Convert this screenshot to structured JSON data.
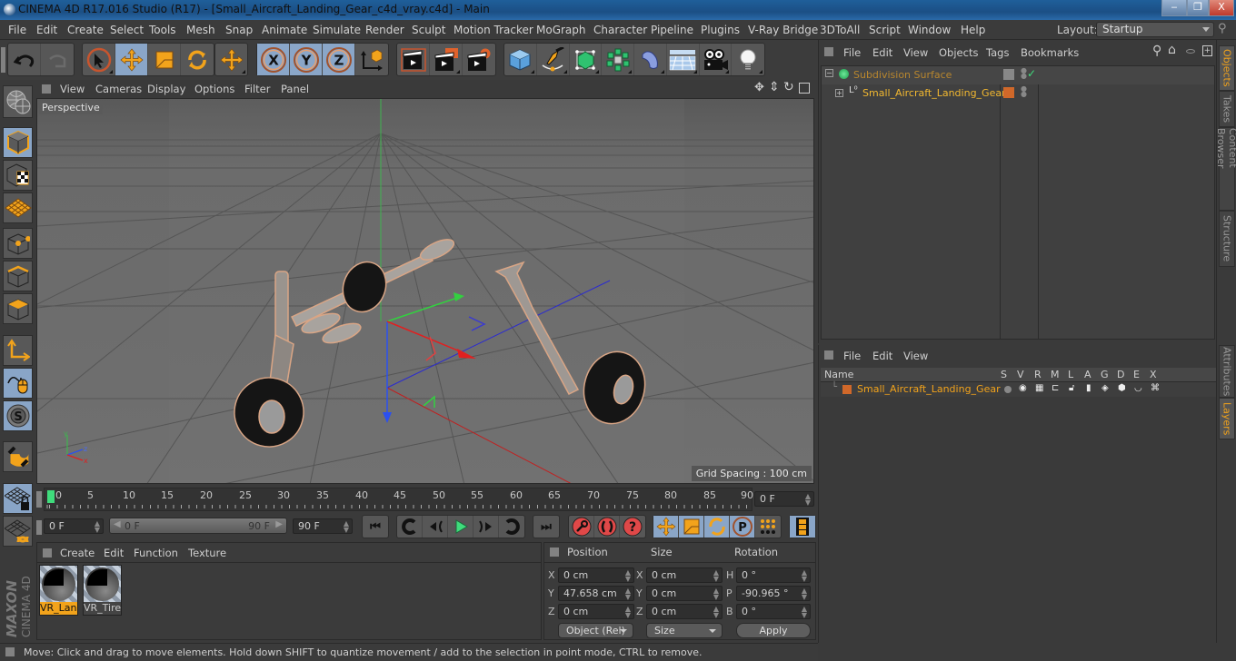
{
  "window": {
    "title": "CINEMA 4D R17.016 Studio (R17) - [Small_Aircraft_Landing_Gear_c4d_vray.c4d] - Main",
    "controls": {
      "minimize": "‒",
      "restore": "❐",
      "close": "X"
    }
  },
  "menubar": {
    "items": [
      "File",
      "Edit",
      "Create",
      "Select",
      "Tools",
      "Mesh",
      "Snap",
      "Animate",
      "Simulate",
      "Render",
      "Sculpt",
      "Motion Tracker",
      "MoGraph",
      "Character",
      "Pipeline",
      "Plugins",
      "V-Ray Bridge",
      "3DToAll",
      "Script",
      "Window",
      "Help"
    ],
    "layout_label": "Layout:",
    "layout_value": "Startup"
  },
  "toolbar": {
    "groups": [
      [
        "undo-icon",
        "redo-icon"
      ],
      [
        "live-selection-icon",
        "move-icon",
        "scale-icon",
        "rotate-icon"
      ],
      [
        "last-tool-icon"
      ],
      [
        "x-axis-lock-icon",
        "y-axis-lock-icon",
        "z-axis-lock-icon",
        "coordinate-system-icon"
      ],
      [
        "render-view-icon",
        "render-to-picture-viewer-icon",
        "render-settings-icon"
      ],
      [
        "cube-primitive-icon",
        "pen-spline-icon",
        "subdivision-surface-icon",
        "cloner-icon",
        "deformer-icon",
        "floor-environment-icon",
        "camera-icon",
        "light-icon"
      ]
    ],
    "active": [
      "move-icon",
      "x-axis-lock-icon",
      "y-axis-lock-icon",
      "z-axis-lock-icon"
    ]
  },
  "left_tools": [
    "make-editable-icon",
    "model-mode-icon",
    "texture-mode-icon",
    "workplane-mode-icon",
    "points-mode-icon",
    "edges-mode-icon",
    "polygons-mode-icon",
    "axis-mode-icon",
    "tweak-mode-icon",
    "solo-mode-icon",
    "snapping-icon",
    "workplane-lock-icon",
    "workplane-align-icon"
  ],
  "viewport": {
    "menu": [
      "View",
      "Cameras",
      "Display",
      "Options",
      "Filter",
      "Panel"
    ],
    "camera_label": "Perspective",
    "grid_spacing": "Grid Spacing : 100 cm",
    "nav_icons": [
      "pan-icon",
      "zoom-icon",
      "orbit-icon",
      "maximize-view-icon"
    ]
  },
  "timeline": {
    "ticks": [
      "0",
      "5",
      "10",
      "15",
      "20",
      "25",
      "30",
      "35",
      "40",
      "45",
      "50",
      "55",
      "60",
      "65",
      "70",
      "75",
      "80",
      "85",
      "90"
    ],
    "current_frame": "0 F",
    "start_field": "0 F",
    "range_start": "0 F",
    "range_end": "90 F",
    "end_field": "90 F"
  },
  "playback": {
    "transport": [
      "go-to-start-icon",
      "go-to-previous-key-icon",
      "step-back-icon",
      "play-icon",
      "step-forward-icon",
      "go-to-next-key-icon",
      "go-to-end-icon"
    ],
    "keyframe": [
      "record-key-icon",
      "autokey-icon",
      "keyframe-selection-icon"
    ],
    "key_tracks": [
      "key-position-icon",
      "key-scale-icon",
      "key-rotation-icon",
      "key-parameter-icon",
      "key-pla-icon"
    ],
    "timeline_button": "timeline-window-icon"
  },
  "material_manager": {
    "menu": [
      "Create",
      "Edit",
      "Function",
      "Texture"
    ],
    "materials": [
      {
        "name": "VR_Land",
        "selected": true
      },
      {
        "name": "VR_Tires",
        "selected": false
      }
    ]
  },
  "coordinates": {
    "headers": [
      "Position",
      "Size",
      "Rotation"
    ],
    "position": [
      {
        "axis": "X",
        "value": "0 cm"
      },
      {
        "axis": "Y",
        "value": "47.658 cm"
      },
      {
        "axis": "Z",
        "value": "0 cm"
      }
    ],
    "size": [
      {
        "axis": "X",
        "value": "0 cm"
      },
      {
        "axis": "Y",
        "value": "0 cm"
      },
      {
        "axis": "Z",
        "value": "0 cm"
      }
    ],
    "rotation": [
      {
        "axis": "H",
        "value": "0 °"
      },
      {
        "axis": "P",
        "value": "-90.965 °"
      },
      {
        "axis": "B",
        "value": "0 °"
      }
    ],
    "mode_dropdown": "Object (Rel)",
    "size_dropdown": "Size",
    "apply_label": "Apply"
  },
  "status": "Move: Click and drag to move elements. Hold down SHIFT to quantize movement / add to the selection in point mode, CTRL to remove.",
  "objects_panel": {
    "menu": [
      "File",
      "Edit",
      "View",
      "Objects",
      "Tags",
      "Bookmarks"
    ],
    "objects": [
      {
        "name": "Subdivision Surface",
        "color": "#b8862e",
        "level": 0
      },
      {
        "name": "Small_Aircraft_Landing_Gear",
        "color": "#f2b830",
        "level": 1
      }
    ]
  },
  "layers_panel": {
    "menu": [
      "File",
      "Edit",
      "View"
    ],
    "columns": [
      "Name",
      "S",
      "V",
      "R",
      "M",
      "L",
      "A",
      "G",
      "D",
      "E",
      "X"
    ],
    "layers": [
      {
        "name": "Small_Aircraft_Landing_Gear",
        "color": "#d0682a"
      }
    ]
  },
  "side_tabs": {
    "top": [
      {
        "label": "Objects",
        "active": true
      },
      {
        "label": "Takes",
        "active": false
      },
      {
        "label": "Content Browser",
        "active": false
      },
      {
        "label": "Structure",
        "active": false
      }
    ],
    "bottom": [
      {
        "label": "Attributes",
        "active": false
      },
      {
        "label": "Layers",
        "active": true
      }
    ]
  },
  "branding": {
    "maxon": "MAXON",
    "product": "CINEMA 4D"
  },
  "colors": {
    "accent": "#f2a31b",
    "active_button": "#8aa6c8",
    "selection_orange": "#e38a2a"
  }
}
